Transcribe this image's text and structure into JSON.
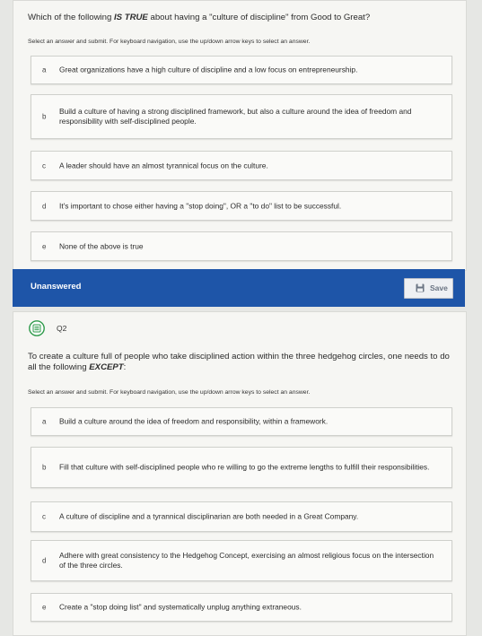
{
  "question1": {
    "text_prefix": "Which of the following ",
    "text_emph": "IS TRUE",
    "text_suffix": " about having a \"culture of discipline\" from Good to Great?",
    "instructions": "Select an answer and submit. For keyboard navigation, use the up/down arrow keys to select an answer.",
    "options": [
      {
        "letter": "a",
        "text": "Great organizations have a high culture of discipline and a low focus on entrepreneurship."
      },
      {
        "letter": "b",
        "text": "Build a culture of having a strong disciplined framework, but also a culture around the idea of freedom and responsibility with self-disciplined people."
      },
      {
        "letter": "c",
        "text": "A leader should have an almost tyrannical focus on the culture."
      },
      {
        "letter": "d",
        "text": "It's important to chose either having a \"stop doing\", OR a \"to do\" list to be successful."
      },
      {
        "letter": "e",
        "text": "None of the above is true"
      }
    ]
  },
  "status_bar": {
    "status": "Unanswered",
    "save_label": "Save"
  },
  "question2": {
    "number": "Q2",
    "text_prefix": "To create a culture full of people who take disciplined action within the three hedgehog circles, one needs to do all the following ",
    "text_emph": "EXCEPT",
    "text_suffix": ":",
    "instructions": "Select an answer and submit. For keyboard navigation, use the up/down arrow keys to select an answer.",
    "options": [
      {
        "letter": "a",
        "text": "Build a culture around the idea of freedom and responsibility, within a framework."
      },
      {
        "letter": "b",
        "text": "Fill that culture with self-disciplined people who re willing to go the extreme lengths to fulfill their responsibilities."
      },
      {
        "letter": "c",
        "text": "A culture of discipline and a tyrannical disciplinarian are both needed in a Great Company."
      },
      {
        "letter": "d",
        "text": "Adhere with great consistency to the Hedgehog Concept, exercising an almost religious focus on the intersection of the three circles."
      },
      {
        "letter": "e",
        "text": "Create a \"stop doing list\" and systematically unplug anything extraneous."
      }
    ]
  },
  "colors": {
    "status_bar": "#1e55a8",
    "page_bg": "#e6e7e4",
    "card_bg": "#f6f6f3",
    "q2_icon": "#2e9a4a"
  },
  "icons": {
    "save": "floppy-disk-icon",
    "question": "question-list-icon"
  }
}
